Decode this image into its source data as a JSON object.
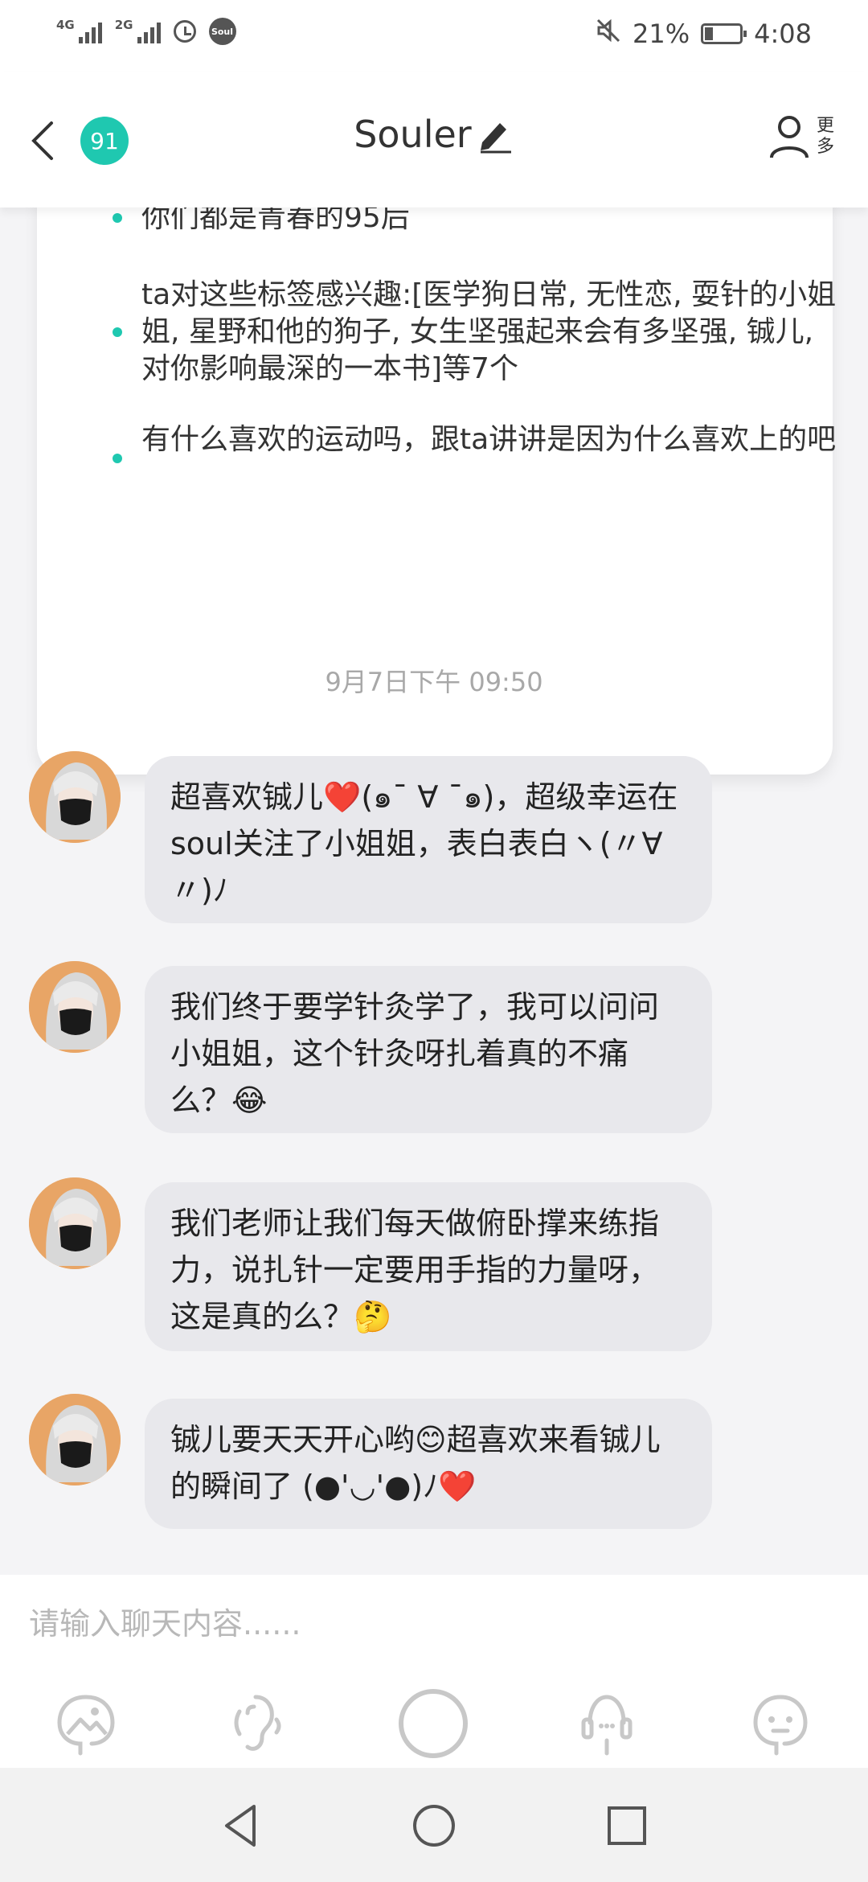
{
  "status_bar": {
    "signal1_label": "4G",
    "signal2_label": "2G",
    "app_badge": "Soul",
    "battery": "21%",
    "time": "4:08"
  },
  "header": {
    "level": "91",
    "title": "Souler",
    "more_label": "更多"
  },
  "intro_tips": [
    "你们都是青春的95后",
    "ta对这些标签感兴趣:[医学狗日常, 无性恋, 耍针的小姐姐, 星野和他的狗子, 女生坚强起来会有多坚强, 铖儿, 对你影响最深的一本书]等7个",
    "有什么喜欢的运动吗，跟ta讲讲是因为什么喜欢上的吧"
  ],
  "timestamp": "9月7日下午 09:50",
  "messages": [
    {
      "text": "超喜欢铖儿❤️(๑¯ ∀ ¯๑)，超级幸运在soul关注了小姐姐，表白表白ヽ(〃∀〃)ﾉ"
    },
    {
      "text": "我们终于要学针灸学了，我可以问问小姐姐，这个针灸呀扎着真的不痛么？😂"
    },
    {
      "text": "我们老师让我们每天做俯卧撑来练指力，说扎针一定要用手指的力量呀，这是真的么？🤔"
    },
    {
      "text": "铖儿要天天开心哟😊超喜欢来看铖儿的瞬间了 (●'◡'●)ﾉ❤️"
    }
  ],
  "input": {
    "placeholder": "请输入聊天内容......",
    "value": ""
  },
  "toolbar_icons": [
    "image-icon",
    "voice-icon",
    "record-icon",
    "voice-call-icon",
    "emoji-icon"
  ],
  "nav_icons": [
    "back-triangle-icon",
    "home-circle-icon",
    "recents-square-icon"
  ],
  "colors": {
    "accent": "#1fc8b0",
    "bubble": "#e8e8ec",
    "background": "#f4f4f6"
  }
}
